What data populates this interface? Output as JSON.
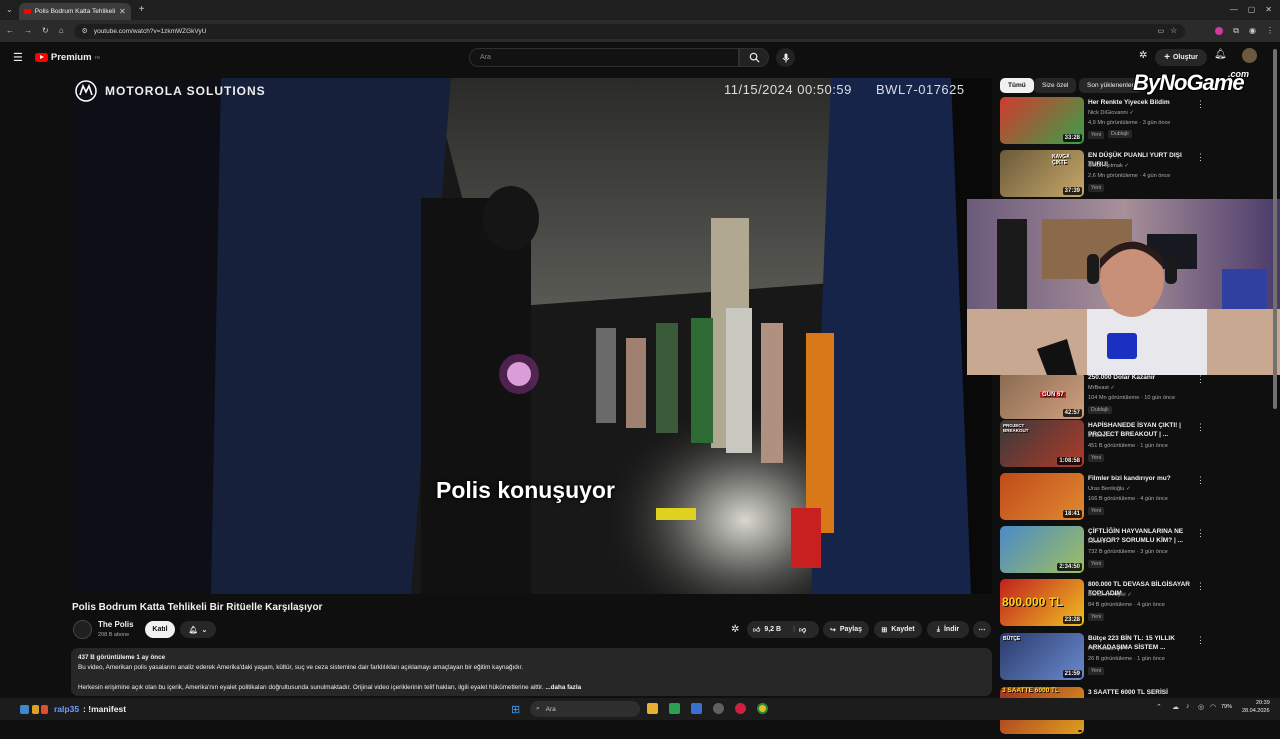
{
  "browser": {
    "tab_title": "Polis Bodrum Katta Tehlikeli Bir",
    "url": "youtube.com/watch?v=1zkmWZGkVyU"
  },
  "header": {
    "brand": "Premium",
    "brand_sup": "TR",
    "search_placeholder": "Ara",
    "create_label": "Oluştur"
  },
  "video": {
    "brand_text": "MOTOROLA SOLUTIONS",
    "timestamp": "11/15/2024 00:50:59",
    "camera_id": "BWL7-017625",
    "subtitle": "Polis konuşuyor"
  },
  "watermark": {
    "text": "ByNoGame",
    "suffix": ".com"
  },
  "info": {
    "title": "Polis Bodrum Katta Tehlikeli Bir Ritüelle Karşılaşıyor",
    "channel": "The Polis",
    "subscribers": "208 B abone",
    "join_label": "Katıl",
    "likes": "9,2 B",
    "share_label": "Paylaş",
    "save_label": "Kaydet",
    "download_label": "İndir"
  },
  "description": {
    "meta": "437 B görüntüleme  1 ay önce",
    "line1": "Bu video, Amerikan polis yasalarını analiz ederek Amerika'daki yaşam, kültür, suç ve ceza sistemine dair farklılıkları açıklamayı amaçlayan bir eğitim kaynağıdır.",
    "line2": "Herkesin erişimine açık olan bu içerik, Amerika'nın eyalet politikaları doğrultusunda sunulmaktadır. Orijinal video içeriklerinin telif hakları, ilgili eyalet hükümetlerine aittir.",
    "more": "...daha fazla"
  },
  "chips": [
    "Tümü",
    "Size özel",
    "Son yüklenenler"
  ],
  "recommendations": [
    {
      "title": "Her Renkte Yiyecek Bildim",
      "channel": "Nick DiGiovanni",
      "views": "4,9 Mn görüntüleme · 3 gün önce",
      "badge": "Yeni",
      "badge2": "Dublajlı",
      "duration": "33:28",
      "color1": "#d23a2e",
      "color2": "#3aa04a"
    },
    {
      "title": "EN DÜŞÜK PUANLI YURT DIŞI TURU!",
      "channel": "Orkun Işıtmak",
      "views": "2,6 Mn görüntüleme · 4 gün önce",
      "badge": "Yeni",
      "badge2": "",
      "duration": "37:39",
      "color1": "#6a5a3a",
      "color2": "#c8a86a"
    },
    {
      "title": "250.000 Dolar Kazanır",
      "channel": "MrBeast",
      "views": "104 Mn görüntüleme · 10 gün önce",
      "badge": "Dublajlı",
      "badge2": "",
      "duration": "42:57",
      "color1": "#8a6a50",
      "color2": "#d0a080"
    },
    {
      "title": "HAPİSHANEDE İSYAN ÇIKTI! | PROJECT BREAKOUT | ...",
      "channel": "Elraenn",
      "views": "451 B görüntüleme · 1 gün önce",
      "badge": "Yeni",
      "badge2": "",
      "duration": "1:08:58",
      "color1": "#3a3a3a",
      "color2": "#b03a2a"
    },
    {
      "title": "Filmler bizi kandırıyor mu?",
      "channel": "Uras Benlioğlu",
      "views": "166 B görüntüleme · 4 gün önce",
      "badge": "Yeni",
      "badge2": "",
      "duration": "18:41",
      "color1": "#c04a1a",
      "color2": "#e08a30"
    },
    {
      "title": "ÇİFTLİĞİN HAYVANLARINA NE OLUYOR? SORUMLU KİM? | ...",
      "channel": "Elraenn",
      "views": "732 B görüntüleme · 3 gün önce",
      "badge": "Yeni",
      "badge2": "",
      "duration": "2:34:50",
      "color1": "#4a8ac8",
      "color2": "#a0c060"
    },
    {
      "title": "800.000 TL DEVASA BİLGİSAYAR TOPLADIM",
      "channel": "Donanım Arşivi",
      "views": "84 B görüntüleme · 4 gün önce",
      "badge": "Yeni",
      "badge2": "",
      "duration": "23:28",
      "color1": "#c02020",
      "color2": "#f0c020"
    },
    {
      "title": "Bütçe 223 BİN TL: 15 YILLIK ARKADAŞIMA SİSTEM ...",
      "channel": "PC Hocası TV",
      "views": "26 B görüntüleme · 1 gün önce",
      "badge": "Yeni",
      "badge2": "",
      "duration": "21:59",
      "color1": "#2a3a6a",
      "color2": "#6a8ad0"
    },
    {
      "title": "3 SAATTE 6000 TL SERİSİ",
      "channel": "",
      "views": "",
      "badge": "",
      "badge2": "",
      "duration": "",
      "color1": "#a03020",
      "color2": "#e0a020"
    }
  ],
  "thumb_texts": {
    "kavga": "KAVGA ÇIKTE",
    "gun": "GÜN 67",
    "hap": "PROJECT BREAKOUT",
    "money": "800.000 TL",
    "butce": "BÜTÇE",
    "saatte": "3 SAATTE 6000 TL"
  },
  "taskbar": {
    "user": "ralp35",
    "message": ": !manifest",
    "search": "Ara",
    "battery": "79%",
    "time": "20:39",
    "date": "28.04.2026"
  }
}
